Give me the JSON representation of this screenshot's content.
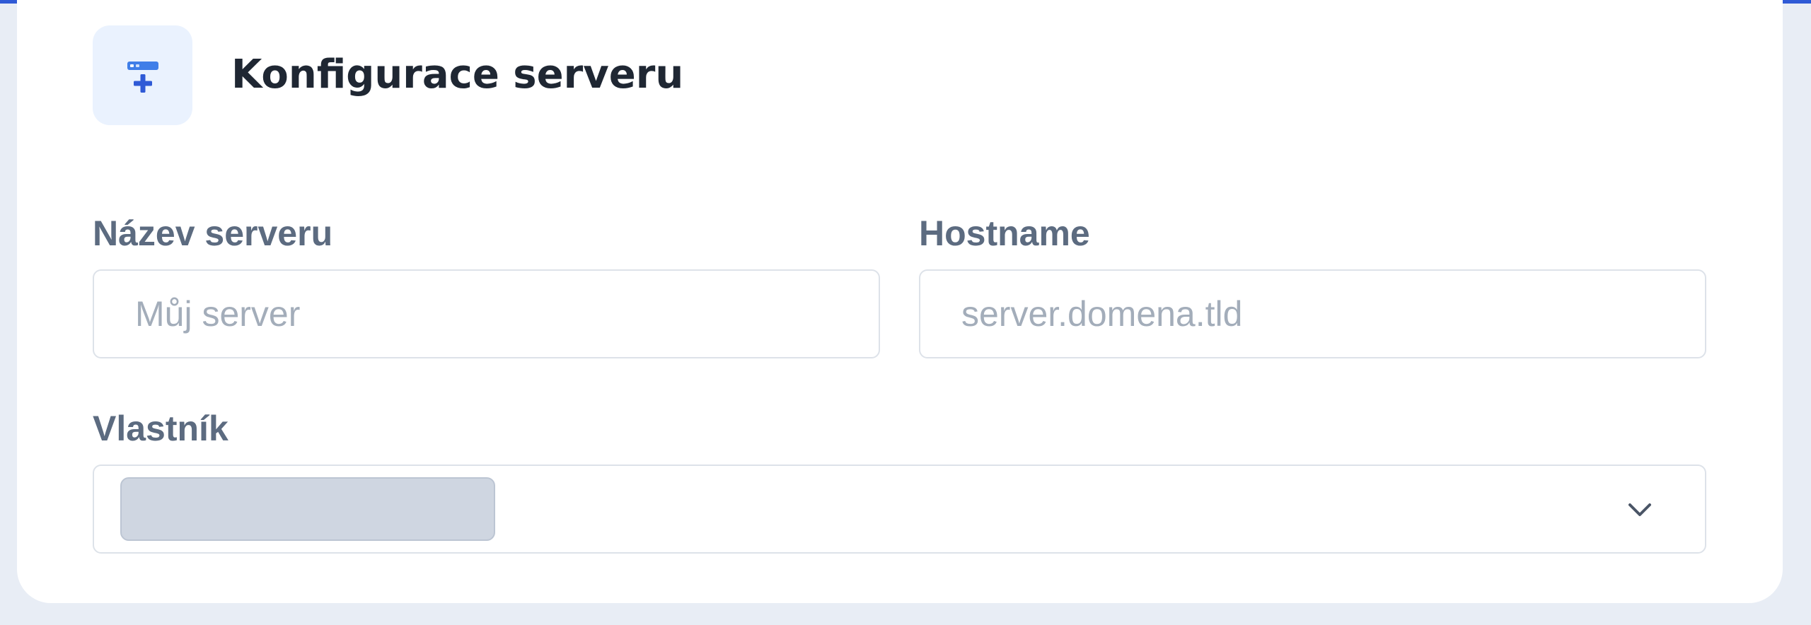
{
  "header": {
    "title": "Konfigurace serveru",
    "icon": "server-add-icon"
  },
  "form": {
    "server_name": {
      "label": "Název serveru",
      "placeholder": "Můj server",
      "value": ""
    },
    "hostname": {
      "label": "Hostname",
      "placeholder": "server.domena.tld",
      "value": ""
    },
    "owner": {
      "label": "Vlastník",
      "selected_value": "",
      "icon": "chevron-down-icon"
    }
  },
  "colors": {
    "accent": "#2f5ad6",
    "page_background": "#e8edf5",
    "icon_tile": "#eaf2fe",
    "label_text": "#5c6b80",
    "placeholder_text": "#a3adba"
  }
}
